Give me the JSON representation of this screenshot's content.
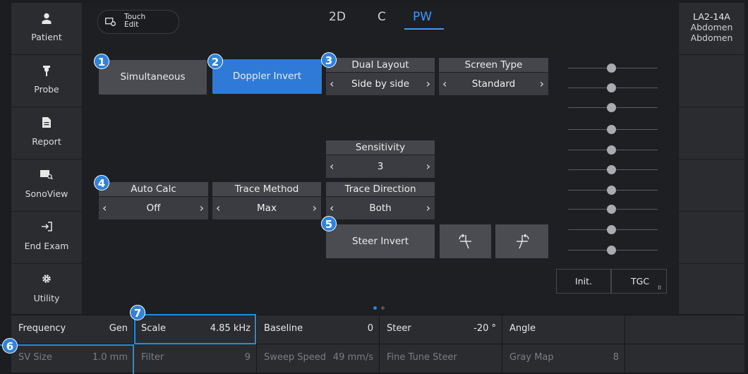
{
  "sidebar": {
    "items": [
      {
        "icon": "person-icon",
        "label": "Patient"
      },
      {
        "icon": "probe-icon",
        "label": "Probe"
      },
      {
        "icon": "document-icon",
        "label": "Report"
      },
      {
        "icon": "sonoview-icon",
        "label": "SonoView"
      },
      {
        "icon": "exit-icon",
        "label": "End Exam"
      },
      {
        "icon": "gear-icon",
        "label": "Utility"
      }
    ]
  },
  "touch_edit": {
    "line1": "Touch",
    "line2": "Edit"
  },
  "tabs": [
    {
      "label": "2D",
      "active": false
    },
    {
      "label": "C",
      "active": false
    },
    {
      "label": "PW",
      "active": true
    }
  ],
  "right_panel": {
    "probe_line1": "LA2-14A",
    "probe_line2": "Abdomen",
    "probe_line3": "Abdomen"
  },
  "controls": {
    "simultaneous": "Simultaneous",
    "doppler_invert": "Doppler Invert",
    "dual_layout": {
      "label": "Dual Layout",
      "value": "Side by side"
    },
    "screen_type": {
      "label": "Screen Type",
      "value": "Standard"
    },
    "sensitivity": {
      "label": "Sensitivity",
      "value": "3"
    },
    "auto_calc": {
      "label": "Auto Calc",
      "value": "Off"
    },
    "trace_method": {
      "label": "Trace Method",
      "value": "Max"
    },
    "trace_direction": {
      "label": "Trace Direction",
      "value": "Both"
    },
    "steer_invert": "Steer Invert",
    "init": "Init.",
    "tgc": "TGC"
  },
  "badges": [
    "1",
    "2",
    "3",
    "4",
    "5",
    "6",
    "7"
  ],
  "bottom": {
    "row1": [
      {
        "key": "Frequency",
        "value": "Gen"
      },
      {
        "key": "Scale",
        "value": "4.85 kHz"
      },
      {
        "key": "Baseline",
        "value": "0"
      },
      {
        "key": "Steer",
        "value": "-20 °"
      },
      {
        "key": "Angle",
        "value": ""
      }
    ],
    "row2": [
      {
        "key": "SV Size",
        "value": "1.0 mm"
      },
      {
        "key": "Filter",
        "value": "9"
      },
      {
        "key": "Sweep Speed",
        "value": "49 mm/s"
      },
      {
        "key": "Fine Tune Steer",
        "value": ""
      },
      {
        "key": "Gray Map",
        "value": "8"
      }
    ]
  },
  "colors": {
    "accent": "#2f7ad6",
    "highlight": "#1e8fe0",
    "active_tab": "#3b9aff"
  }
}
